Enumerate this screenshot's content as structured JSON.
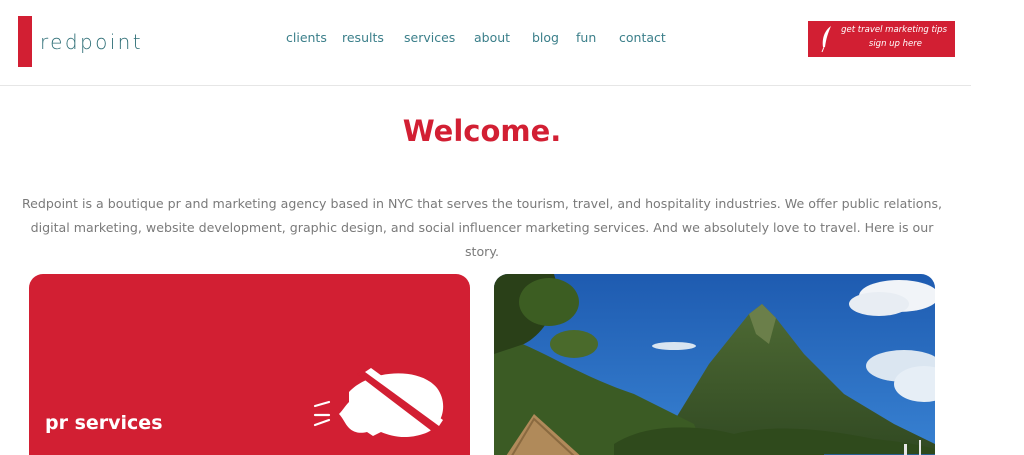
{
  "brand": {
    "name": "redpoint",
    "accent": "#d21f33",
    "nav_color": "#3b7f8a"
  },
  "nav": {
    "items": [
      {
        "label": "clients"
      },
      {
        "label": "results"
      },
      {
        "label": "services"
      },
      {
        "label": "about"
      },
      {
        "label": "blog"
      },
      {
        "label": "fun"
      },
      {
        "label": "contact"
      }
    ]
  },
  "cta": {
    "line1": "get travel marketing tips",
    "line2": "sign up here",
    "icon": "feather-icon"
  },
  "main": {
    "title": "Welcome.",
    "intro": "Redpoint is a boutique pr and marketing agency based in NYC that serves the tourism, travel, and hospitality industries. We offer public relations, digital marketing, website development, graphic design, and social influencer marketing services. And we absolutely love to travel. Here is our story."
  },
  "cards": [
    {
      "title": "pr services",
      "icon": "megaphone-icon"
    },
    {
      "image": "tropical-mountain-photo"
    }
  ]
}
